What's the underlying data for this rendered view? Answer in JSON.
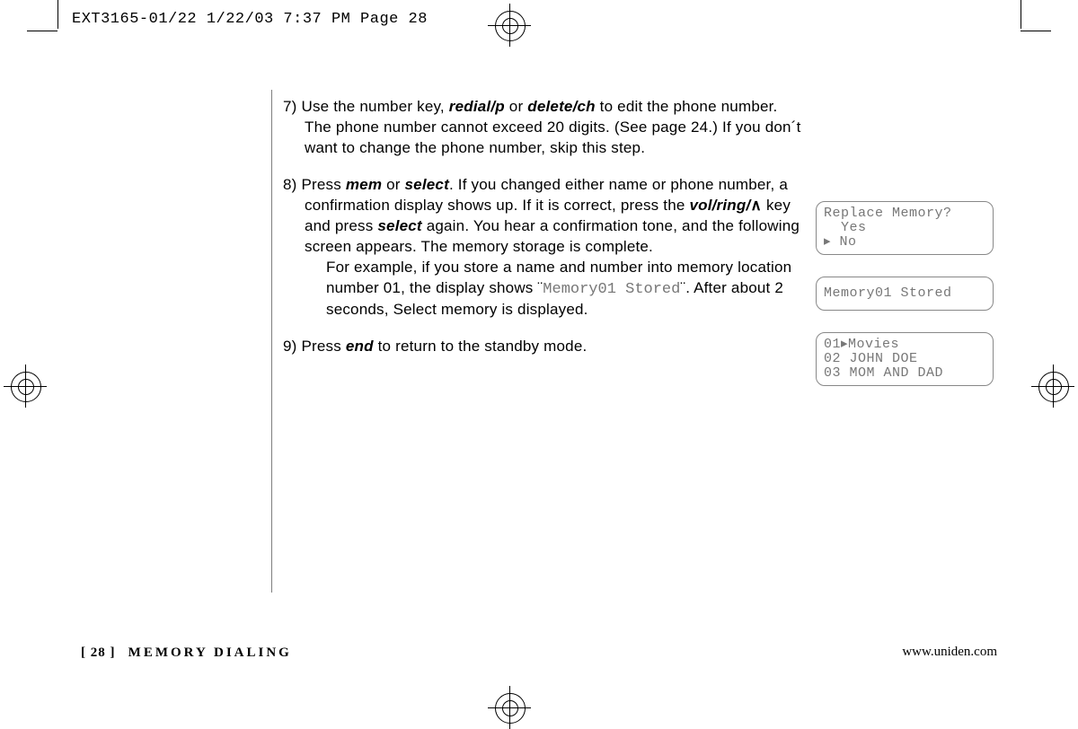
{
  "slug": "EXT3165-01/22  1/22/03  7:37 PM  Page 28",
  "steps": {
    "s7": {
      "num": "7)",
      "pre": "Use the number key, ",
      "kb1": "redial/p",
      "mid1": " or ",
      "kb2": "delete/ch",
      "post": " to edit the phone number. The phone number cannot exceed 20 digits. (See page 24.) If you don´t want to change the phone number, skip this step."
    },
    "s8": {
      "num": "8)",
      "pre": "Press ",
      "kb1": "mem",
      "mid1": " or ",
      "kb2": "select",
      "mid2": ". If you changed either name or phone number, a confirmation display shows up. If it is correct, press the ",
      "kb3": "vol/ring/",
      "caret": "∧",
      "mid3": " key and press ",
      "kb4": "select",
      "mid4": " again. You hear a confirmation tone, and the following screen appears. The memory storage is complete.",
      "para2a": "For example, if you store a name and number into memory location number 01, the display shows ¨",
      "lcd": "Memory01 Stored",
      "para2b": "¨. After about 2 seconds, Select memory is displayed."
    },
    "s9": {
      "num": "9)",
      "pre": "Press ",
      "kb1": "end",
      "post": " to return to the standby mode."
    }
  },
  "lcd": {
    "box1_l1": "Replace Memory?",
    "box1_l2": "  Yes",
    "box1_l3": " No",
    "box2": "Memory01 Stored",
    "box3_l1": "01 Movies",
    "box3_l2": "02 JOHN DOE",
    "box3_l3": "03 MOM AND DAD"
  },
  "footer": {
    "page": "[ 28 ]",
    "section": "MEMORY DIALING",
    "url": "www.uniden.com"
  }
}
